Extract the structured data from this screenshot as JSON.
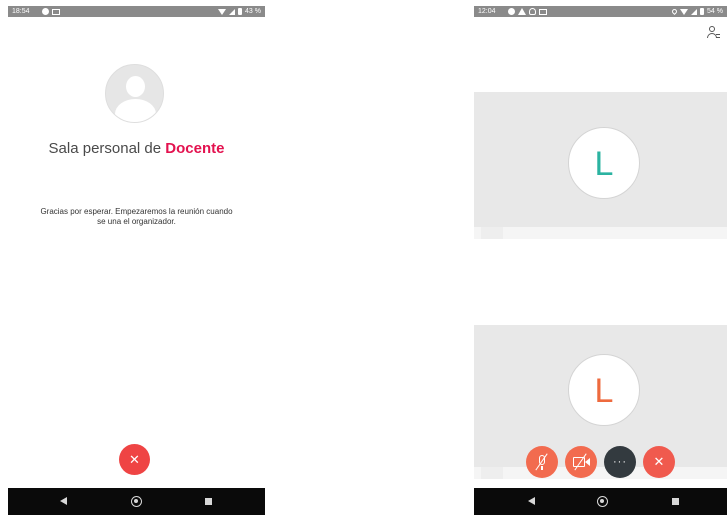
{
  "left_phone": {
    "status": {
      "time": "18:54",
      "battery": "43 %"
    },
    "room_title_prefix": "Sala personal de ",
    "room_host": "Docente",
    "wait_message": "Gracias por esperar. Empezaremos la reunión cuando se una el organizador.",
    "leave_icon": "✕"
  },
  "right_phone": {
    "status": {
      "time": "12:04",
      "battery": "54 %"
    },
    "participants": [
      {
        "initial": "L",
        "color": "#2bb3a1"
      },
      {
        "initial": "L",
        "color": "#ee6a3e"
      }
    ],
    "controls": {
      "more_label": "···",
      "end_icon": "✕"
    }
  },
  "icons": {
    "participants": "participants-icon",
    "mute": "mic-off-icon",
    "video": "video-off-icon",
    "more": "more-icon",
    "end": "close-icon"
  },
  "colors": {
    "accent": "#e3124f",
    "leave_red": "#ef4444",
    "control_orange": "#f26b4f",
    "control_dark": "#333a3f"
  }
}
